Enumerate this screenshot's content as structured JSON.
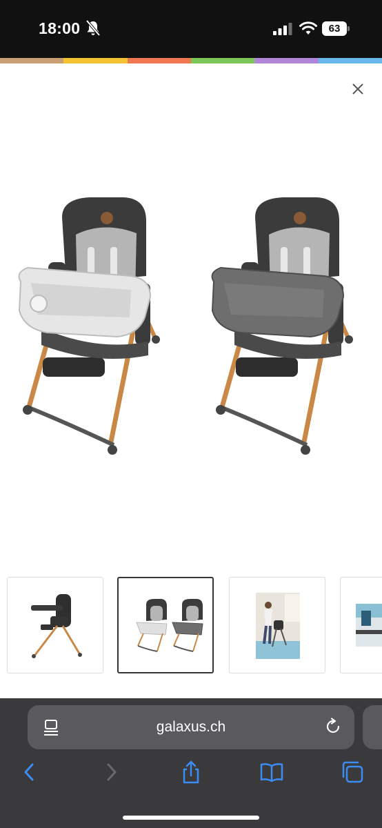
{
  "status_bar": {
    "time": "18:00",
    "battery": "63",
    "icons": [
      "bell-slash-icon",
      "cellular-signal-icon",
      "wifi-icon",
      "battery-icon"
    ]
  },
  "brand_stripe_colors": [
    "#c9a074",
    "#f5c234",
    "#f07850",
    "#7dc758",
    "#b086d8",
    "#68b8ec"
  ],
  "gallery": {
    "close_icon": "close-icon",
    "main_image": "two-high-chairs-photo",
    "thumbnails": [
      {
        "name": "high-chair-side-view-photo",
        "selected": false
      },
      {
        "name": "two-high-chairs-photo",
        "selected": true
      },
      {
        "name": "woman-with-high-chair-photo",
        "selected": false
      },
      {
        "name": "kitchen-scene-photo",
        "selected": false
      }
    ]
  },
  "browser": {
    "url": "galaxus.ch",
    "accent_color": "#3b8df5",
    "toolbar": [
      "back-icon",
      "forward-icon",
      "share-icon",
      "bookmarks-icon",
      "tabs-icon"
    ]
  }
}
